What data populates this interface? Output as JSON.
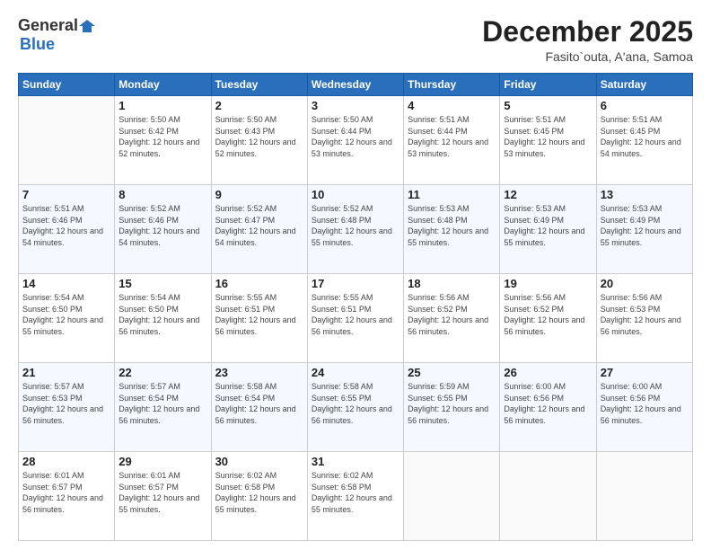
{
  "logo": {
    "general": "General",
    "blue": "Blue"
  },
  "header": {
    "title": "December 2025",
    "subtitle": "Fasito`outa, A'ana, Samoa"
  },
  "weekdays": [
    "Sunday",
    "Monday",
    "Tuesday",
    "Wednesday",
    "Thursday",
    "Friday",
    "Saturday"
  ],
  "weeks": [
    [
      {
        "day": "",
        "sunrise": "",
        "sunset": "",
        "daylight": ""
      },
      {
        "day": "1",
        "sunrise": "Sunrise: 5:50 AM",
        "sunset": "Sunset: 6:42 PM",
        "daylight": "Daylight: 12 hours and 52 minutes."
      },
      {
        "day": "2",
        "sunrise": "Sunrise: 5:50 AM",
        "sunset": "Sunset: 6:43 PM",
        "daylight": "Daylight: 12 hours and 52 minutes."
      },
      {
        "day": "3",
        "sunrise": "Sunrise: 5:50 AM",
        "sunset": "Sunset: 6:44 PM",
        "daylight": "Daylight: 12 hours and 53 minutes."
      },
      {
        "day": "4",
        "sunrise": "Sunrise: 5:51 AM",
        "sunset": "Sunset: 6:44 PM",
        "daylight": "Daylight: 12 hours and 53 minutes."
      },
      {
        "day": "5",
        "sunrise": "Sunrise: 5:51 AM",
        "sunset": "Sunset: 6:45 PM",
        "daylight": "Daylight: 12 hours and 53 minutes."
      },
      {
        "day": "6",
        "sunrise": "Sunrise: 5:51 AM",
        "sunset": "Sunset: 6:45 PM",
        "daylight": "Daylight: 12 hours and 54 minutes."
      }
    ],
    [
      {
        "day": "7",
        "sunrise": "Sunrise: 5:51 AM",
        "sunset": "Sunset: 6:46 PM",
        "daylight": "Daylight: 12 hours and 54 minutes."
      },
      {
        "day": "8",
        "sunrise": "Sunrise: 5:52 AM",
        "sunset": "Sunset: 6:46 PM",
        "daylight": "Daylight: 12 hours and 54 minutes."
      },
      {
        "day": "9",
        "sunrise": "Sunrise: 5:52 AM",
        "sunset": "Sunset: 6:47 PM",
        "daylight": "Daylight: 12 hours and 54 minutes."
      },
      {
        "day": "10",
        "sunrise": "Sunrise: 5:52 AM",
        "sunset": "Sunset: 6:48 PM",
        "daylight": "Daylight: 12 hours and 55 minutes."
      },
      {
        "day": "11",
        "sunrise": "Sunrise: 5:53 AM",
        "sunset": "Sunset: 6:48 PM",
        "daylight": "Daylight: 12 hours and 55 minutes."
      },
      {
        "day": "12",
        "sunrise": "Sunrise: 5:53 AM",
        "sunset": "Sunset: 6:49 PM",
        "daylight": "Daylight: 12 hours and 55 minutes."
      },
      {
        "day": "13",
        "sunrise": "Sunrise: 5:53 AM",
        "sunset": "Sunset: 6:49 PM",
        "daylight": "Daylight: 12 hours and 55 minutes."
      }
    ],
    [
      {
        "day": "14",
        "sunrise": "Sunrise: 5:54 AM",
        "sunset": "Sunset: 6:50 PM",
        "daylight": "Daylight: 12 hours and 55 minutes."
      },
      {
        "day": "15",
        "sunrise": "Sunrise: 5:54 AM",
        "sunset": "Sunset: 6:50 PM",
        "daylight": "Daylight: 12 hours and 56 minutes."
      },
      {
        "day": "16",
        "sunrise": "Sunrise: 5:55 AM",
        "sunset": "Sunset: 6:51 PM",
        "daylight": "Daylight: 12 hours and 56 minutes."
      },
      {
        "day": "17",
        "sunrise": "Sunrise: 5:55 AM",
        "sunset": "Sunset: 6:51 PM",
        "daylight": "Daylight: 12 hours and 56 minutes."
      },
      {
        "day": "18",
        "sunrise": "Sunrise: 5:56 AM",
        "sunset": "Sunset: 6:52 PM",
        "daylight": "Daylight: 12 hours and 56 minutes."
      },
      {
        "day": "19",
        "sunrise": "Sunrise: 5:56 AM",
        "sunset": "Sunset: 6:52 PM",
        "daylight": "Daylight: 12 hours and 56 minutes."
      },
      {
        "day": "20",
        "sunrise": "Sunrise: 5:56 AM",
        "sunset": "Sunset: 6:53 PM",
        "daylight": "Daylight: 12 hours and 56 minutes."
      }
    ],
    [
      {
        "day": "21",
        "sunrise": "Sunrise: 5:57 AM",
        "sunset": "Sunset: 6:53 PM",
        "daylight": "Daylight: 12 hours and 56 minutes."
      },
      {
        "day": "22",
        "sunrise": "Sunrise: 5:57 AM",
        "sunset": "Sunset: 6:54 PM",
        "daylight": "Daylight: 12 hours and 56 minutes."
      },
      {
        "day": "23",
        "sunrise": "Sunrise: 5:58 AM",
        "sunset": "Sunset: 6:54 PM",
        "daylight": "Daylight: 12 hours and 56 minutes."
      },
      {
        "day": "24",
        "sunrise": "Sunrise: 5:58 AM",
        "sunset": "Sunset: 6:55 PM",
        "daylight": "Daylight: 12 hours and 56 minutes."
      },
      {
        "day": "25",
        "sunrise": "Sunrise: 5:59 AM",
        "sunset": "Sunset: 6:55 PM",
        "daylight": "Daylight: 12 hours and 56 minutes."
      },
      {
        "day": "26",
        "sunrise": "Sunrise: 6:00 AM",
        "sunset": "Sunset: 6:56 PM",
        "daylight": "Daylight: 12 hours and 56 minutes."
      },
      {
        "day": "27",
        "sunrise": "Sunrise: 6:00 AM",
        "sunset": "Sunset: 6:56 PM",
        "daylight": "Daylight: 12 hours and 56 minutes."
      }
    ],
    [
      {
        "day": "28",
        "sunrise": "Sunrise: 6:01 AM",
        "sunset": "Sunset: 6:57 PM",
        "daylight": "Daylight: 12 hours and 56 minutes."
      },
      {
        "day": "29",
        "sunrise": "Sunrise: 6:01 AM",
        "sunset": "Sunset: 6:57 PM",
        "daylight": "Daylight: 12 hours and 55 minutes."
      },
      {
        "day": "30",
        "sunrise": "Sunrise: 6:02 AM",
        "sunset": "Sunset: 6:58 PM",
        "daylight": "Daylight: 12 hours and 55 minutes."
      },
      {
        "day": "31",
        "sunrise": "Sunrise: 6:02 AM",
        "sunset": "Sunset: 6:58 PM",
        "daylight": "Daylight: 12 hours and 55 minutes."
      },
      {
        "day": "",
        "sunrise": "",
        "sunset": "",
        "daylight": ""
      },
      {
        "day": "",
        "sunrise": "",
        "sunset": "",
        "daylight": ""
      },
      {
        "day": "",
        "sunrise": "",
        "sunset": "",
        "daylight": ""
      }
    ]
  ]
}
